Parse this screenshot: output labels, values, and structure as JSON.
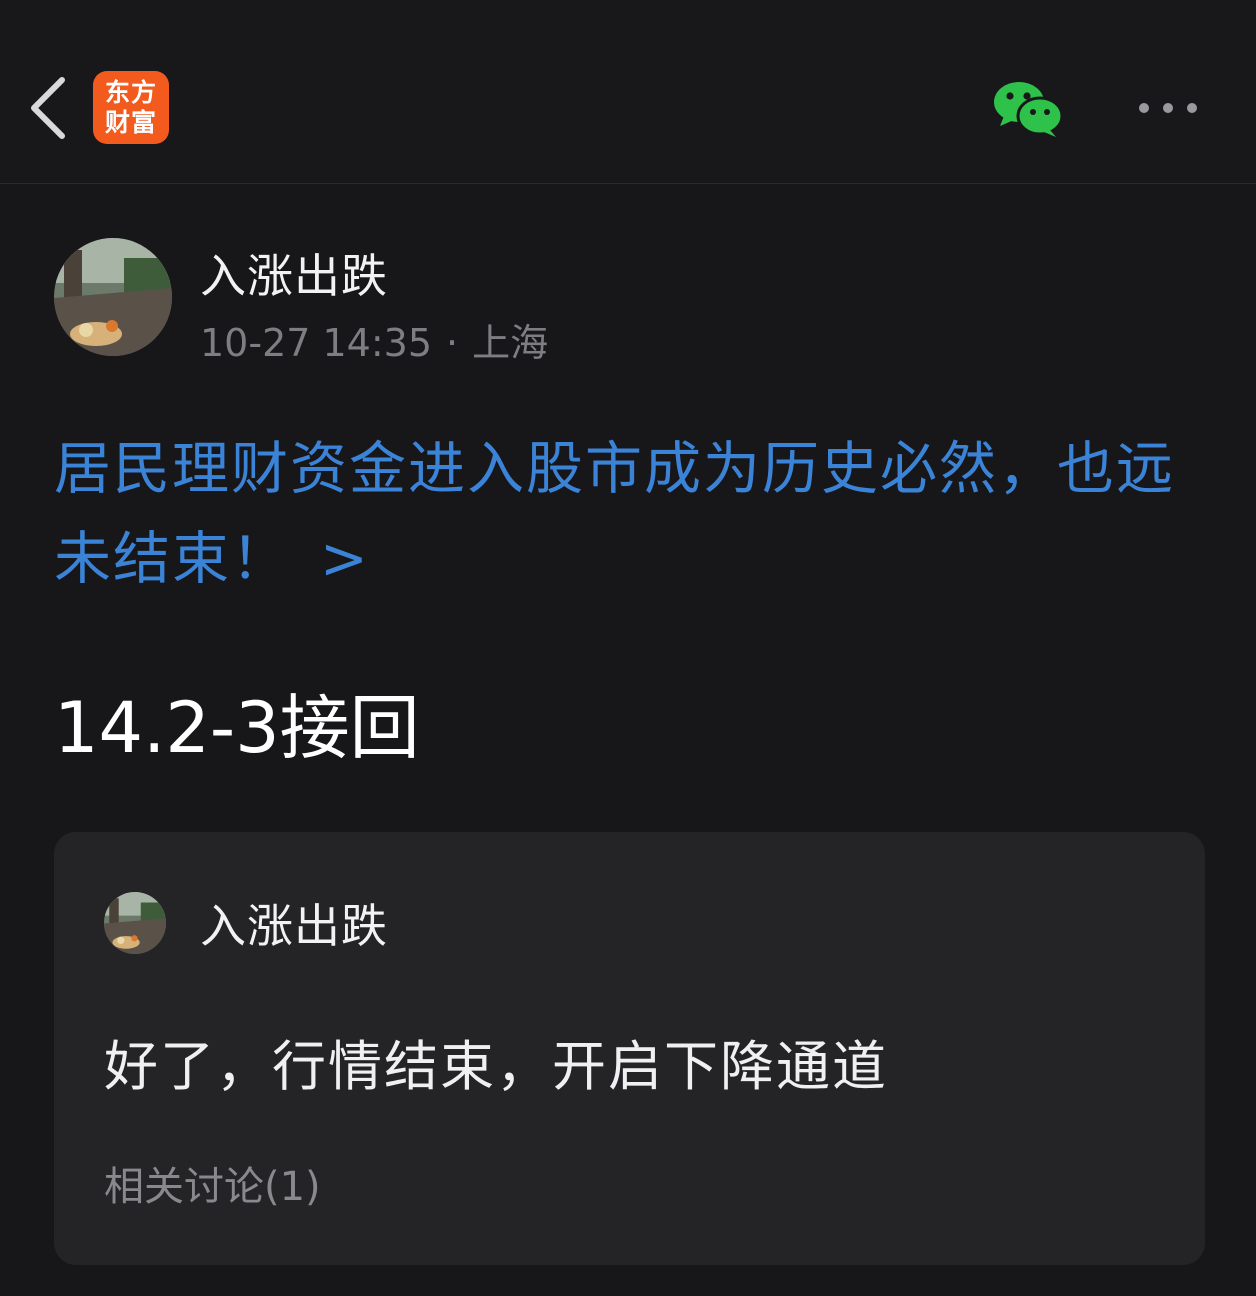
{
  "header": {
    "back_icon": "chevron-left-icon",
    "logo_line1": "东方",
    "logo_line2": "财富",
    "share_icon": "wechat-icon",
    "more_icon": "more-horizontal-icon",
    "logo_color": "#f25a1e",
    "wechat_color": "#2fc24a"
  },
  "post": {
    "author": "入涨出跌",
    "time": "10-27 14:35",
    "separator": "·",
    "location": "上海",
    "topic": "居民理财资金进入股市成为历史必然，也远未结束！",
    "topic_arrow": ">",
    "topic_color": "#3b83d6",
    "body": "14.2-3接回"
  },
  "quote": {
    "author": "入涨出跌",
    "text": "好了，行情结束，开启下降通道",
    "related": "相关讨论(1)"
  }
}
